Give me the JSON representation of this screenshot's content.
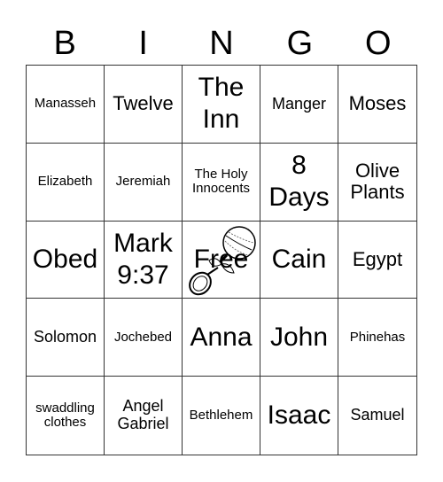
{
  "header": [
    "B",
    "I",
    "N",
    "G",
    "O"
  ],
  "cells": [
    {
      "text": "Manasseh",
      "size": "s"
    },
    {
      "text": "Twelve",
      "size": "l"
    },
    {
      "text": "The Inn",
      "size": "xl"
    },
    {
      "text": "Manger",
      "size": "m"
    },
    {
      "text": "Moses",
      "size": "l"
    },
    {
      "text": "Elizabeth",
      "size": "s"
    },
    {
      "text": "Jeremiah",
      "size": "s"
    },
    {
      "text": "The Holy Innocents",
      "size": "s"
    },
    {
      "text": "8 Days",
      "size": "xl"
    },
    {
      "text": "Olive Plants",
      "size": "l"
    },
    {
      "text": "Obed",
      "size": "xl"
    },
    {
      "text": "Mark 9:37",
      "size": "xl"
    },
    {
      "text": "Free",
      "size": "free",
      "icon": "baby-rattle-icon"
    },
    {
      "text": "Cain",
      "size": "xl"
    },
    {
      "text": "Egypt",
      "size": "l"
    },
    {
      "text": "Solomon",
      "size": "m"
    },
    {
      "text": "Jochebed",
      "size": "s"
    },
    {
      "text": "Anna",
      "size": "xl"
    },
    {
      "text": "John",
      "size": "xl"
    },
    {
      "text": "Phinehas",
      "size": "s"
    },
    {
      "text": "swaddling clothes",
      "size": "s"
    },
    {
      "text": "Angel Gabriel",
      "size": "m"
    },
    {
      "text": "Bethlehem",
      "size": "s"
    },
    {
      "text": "Isaac",
      "size": "xl"
    },
    {
      "text": "Samuel",
      "size": "m"
    }
  ]
}
